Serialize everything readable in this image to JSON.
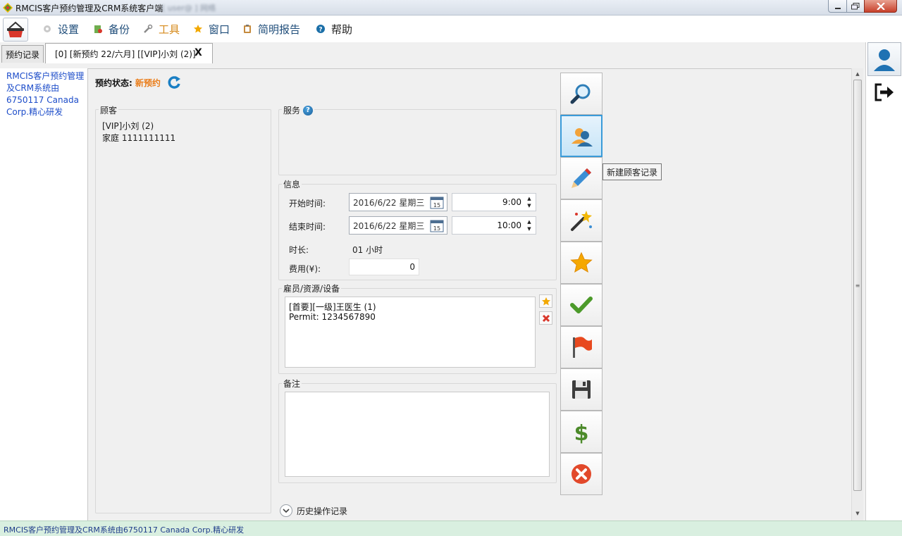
{
  "window": {
    "title": "RMCIS客户预约管理及CRM系统客户端",
    "blurred_suffix": "[ user@ ] 网络"
  },
  "menu": {
    "settings": "设置",
    "backup": "备份",
    "tools": "工具",
    "window": "窗口",
    "report": "简明报告",
    "help": "帮助"
  },
  "tabs": {
    "records": "预约记录",
    "active": "[0] [新预约 22/六月] [[VIP]小刘 (2)]",
    "close": "X"
  },
  "left_pane": {
    "credit": "RMCIS客户预约管理及CRM系统由6750117 Canada Corp.精心研发"
  },
  "status": {
    "label": "预约状态:",
    "value": "新预约"
  },
  "customer": {
    "title": "顾客",
    "name": "[VIP]小刘 (2)",
    "phone": "家庭 1111111111"
  },
  "service": {
    "title": "服务"
  },
  "info": {
    "title": "信息",
    "start_label": "开始时间:",
    "start_date": "2016/6/22 星期三",
    "start_time": "9:00",
    "end_label": "结束时间:",
    "end_date": "2016/6/22 星期三",
    "end_time": "10:00",
    "duration_label": "时长:",
    "duration_value": "01 小时",
    "fee_label": "费用(¥):",
    "fee_value": "0",
    "calendar_day": "15"
  },
  "staff": {
    "title": "雇员/资源/设备",
    "items": [
      "[首要][一级]王医生 (1)",
      "Permit: 1234567890"
    ]
  },
  "notes": {
    "title": "备注"
  },
  "history": {
    "label": "历史操作记录"
  },
  "actions": {
    "tooltip": "新建顾客记录",
    "icons": [
      "search-icon",
      "new-customer-icon",
      "edit-icon",
      "magic-wand-icon",
      "star-icon",
      "check-icon",
      "flag-icon",
      "save-icon",
      "dollar-icon",
      "cancel-icon"
    ]
  },
  "statusbar": {
    "text": "RMCIS客户预约管理及CRM系统由6750117 Canada Corp.精心研发"
  },
  "colors": {
    "status_orange": "#ea7d1a",
    "link_blue": "#1c4cc9",
    "accent_blue": "#3a9bd9",
    "statusbar_green": "#d9efe0"
  }
}
